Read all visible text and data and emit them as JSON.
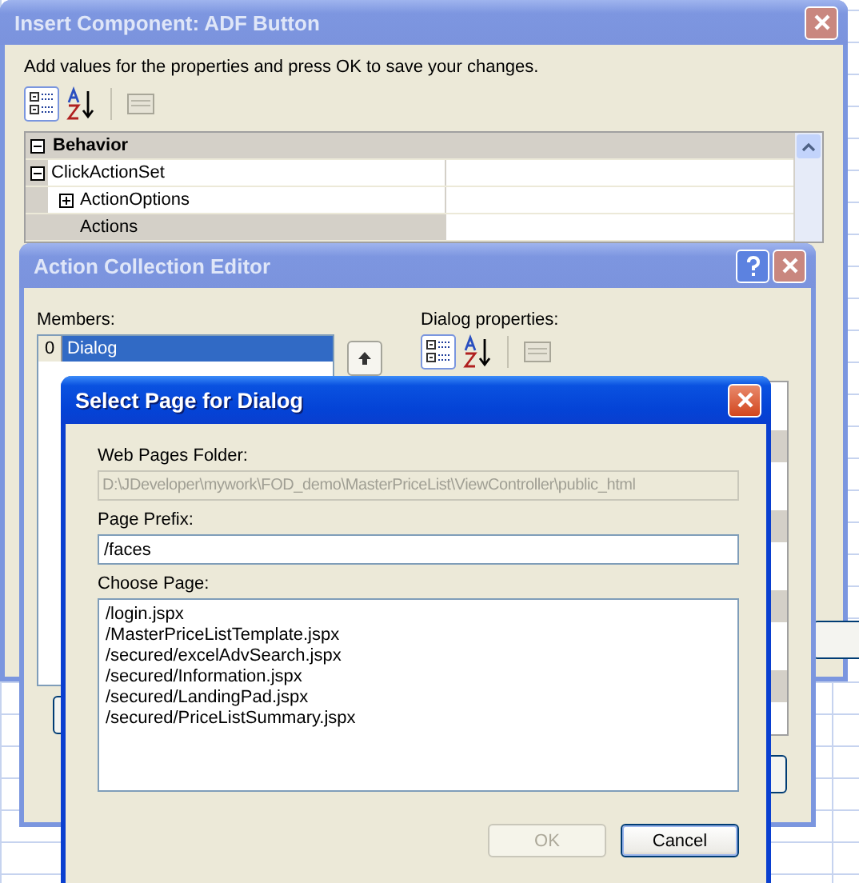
{
  "insert_component_window": {
    "title": "Insert Component: ADF Button",
    "active": false,
    "instruction": "Add values for the properties and press OK to save your changes.",
    "properties": [
      {
        "name": "Behavior",
        "kind": "category",
        "expanded": true,
        "children": [
          {
            "name": "ClickActionSet",
            "kind": "property",
            "expanded": true,
            "selected": false,
            "children": [
              {
                "name": "ActionOptions",
                "kind": "property",
                "expanded": false,
                "selected": false
              },
              {
                "name": "Actions",
                "kind": "property",
                "selected": true
              }
            ]
          }
        ]
      }
    ]
  },
  "action_collection_editor": {
    "title": "Action Collection Editor",
    "active": false,
    "members_label": "Members:",
    "members": [
      {
        "index": "0",
        "label": "Dialog",
        "selected": true
      }
    ],
    "properties_label": "Dialog properties:"
  },
  "select_page_dialog": {
    "title": "Select Page for Dialog",
    "active": true,
    "folder": {
      "label": "Web Pages Folder:",
      "value": "D:\\JDeveloper\\mywork\\FOD_demo\\MasterPriceList\\ViewController\\public_html",
      "disabled": true
    },
    "prefix": {
      "label": "Page Prefix:",
      "value": "/faces"
    },
    "choose_page": {
      "label": "Choose Page:",
      "items": [
        "/login.jspx",
        "/MasterPriceListTemplate.jspx",
        "/secured/excelAdvSearch.jspx",
        "/secured/Information.jspx",
        "/secured/LandingPad.jspx",
        "/secured/PriceListSummary.jspx"
      ]
    },
    "buttons": [
      {
        "label": "OK",
        "disabled": true
      },
      {
        "label": "Cancel",
        "disabled": false
      }
    ]
  }
}
